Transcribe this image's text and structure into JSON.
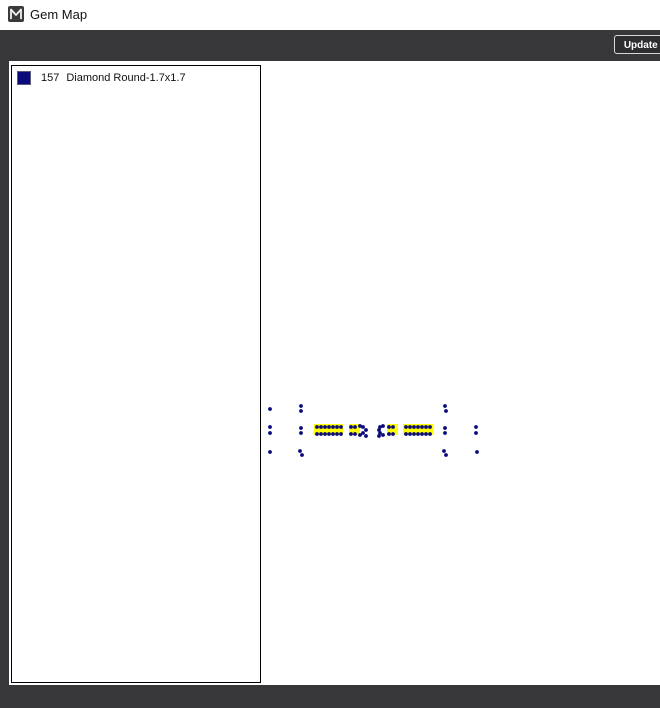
{
  "window": {
    "title": "Gem Map",
    "icon": "m-logo-icon"
  },
  "toolbar": {
    "update_label": "Update S"
  },
  "legend": {
    "items": [
      {
        "count": "157",
        "name": "Diamond Round-1.7x1.7",
        "color": "#0a0a7a"
      }
    ]
  },
  "colors": {
    "frame": "#37373a",
    "stone_blue": "#0a0a7a",
    "highlight_yellow": "#ffff00"
  }
}
